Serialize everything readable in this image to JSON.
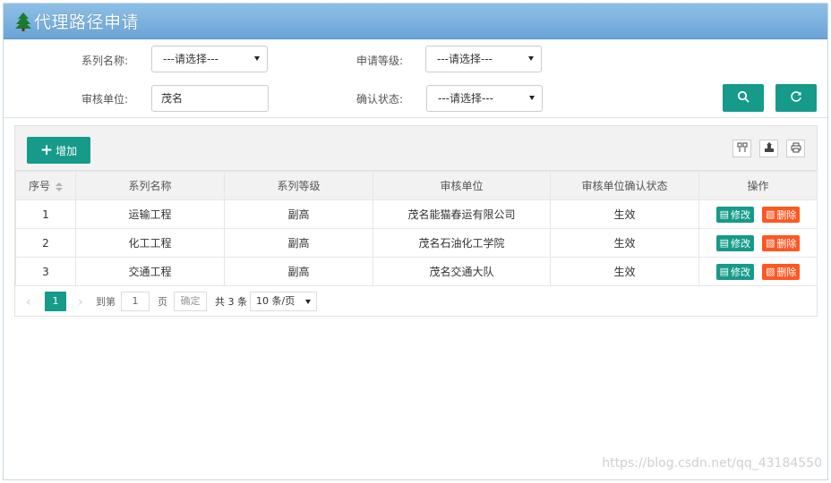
{
  "header": {
    "title": "代理路径申请",
    "icon": "tree-icon",
    "gradient": [
      "#8ec0e6",
      "#6aa4d6"
    ]
  },
  "filters": {
    "series_name": {
      "label": "系列名称:",
      "value": "---请选择---"
    },
    "apply_level": {
      "label": "申请等级:",
      "value": "---请选择---"
    },
    "review_unit": {
      "label": "审核单位:",
      "value": "茂名"
    },
    "confirm_status": {
      "label": "确认状态:",
      "value": "---请选择---"
    }
  },
  "actions": {
    "search_icon": "search-icon",
    "refresh_icon": "refresh-icon"
  },
  "toolbar": {
    "add_label": "增加",
    "tools": [
      "columns-icon",
      "export-icon",
      "print-icon"
    ]
  },
  "table": {
    "headers": [
      "序号",
      "系列名称",
      "系列等级",
      "审核单位",
      "审核单位确认状态",
      "操作"
    ],
    "rows": [
      {
        "index": "1",
        "series": "运输工程",
        "level": "副高",
        "unit": "茂名能猫春运有限公司",
        "status": "生效"
      },
      {
        "index": "2",
        "series": "化工工程",
        "level": "副高",
        "unit": "茂名石油化工学院",
        "status": "生效"
      },
      {
        "index": "3",
        "series": "交通工程",
        "level": "副高",
        "unit": "茂名交通大队",
        "status": "生效"
      }
    ],
    "edit_label": "修改",
    "delete_label": "删除"
  },
  "pagination": {
    "current": "1",
    "goto_label": "到第",
    "goto_value": "1",
    "page_label": "页",
    "confirm_label": "确定",
    "total": "共 3 条",
    "page_size": "10 条/页"
  },
  "colors": {
    "primary": "#169a8a",
    "danger": "#ff5722"
  },
  "watermark": "https://blog.csdn.net/qq_43184550"
}
